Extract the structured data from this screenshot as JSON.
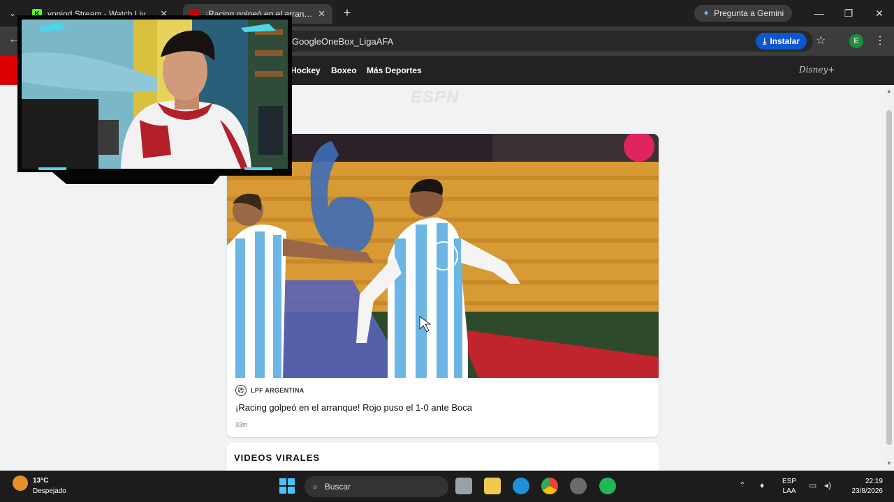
{
  "browser": {
    "tabs": [
      {
        "title": "yoniod Stream - Watch Live on",
        "favicon": "kick-icon",
        "color": "#53fc18"
      },
      {
        "title": "¡Racing golpeó en el arranque!",
        "favicon": "espn-icon",
        "color": "#d00000"
      }
    ],
    "gemini_label": "Pregunta a Gemini",
    "address_text": "GoogleOneBox_LigaAFA",
    "install_label": "Instalar",
    "profile_initial": "E"
  },
  "espn_nav": {
    "items": [
      "Hockey",
      "Boxeo",
      "Más Deportes"
    ],
    "disney_label": "Disney+"
  },
  "page": {
    "watermark": "ESPN",
    "video_card": {
      "league": "LPF ARGENTINA",
      "headline": "¡Racing golpeó en el arranque! Rojo puso el 1-0 ante Boca",
      "time": "33m"
    },
    "viral_section_title": "VIDEOS VIRALES"
  },
  "taskbar": {
    "weather_temp": "13°C",
    "weather_desc": "Despejado",
    "search_label": "Buscar",
    "lang_line1": "ESP",
    "lang_line2": "LAA",
    "time": "22:19",
    "date": "23/8/2026"
  },
  "colors": {
    "install_blue": "#0b57d0",
    "espn_red": "#dd0000",
    "racing_blue": "#6cb6e6"
  }
}
